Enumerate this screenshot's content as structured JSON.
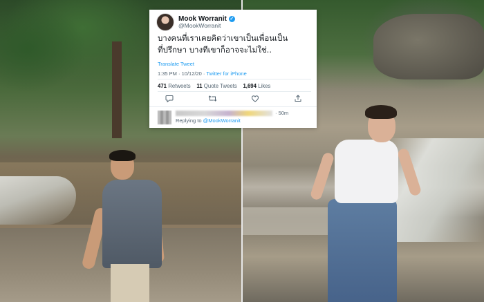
{
  "tweet": {
    "display_name": "Mook Worranit",
    "handle": "@MookWorranit",
    "verified_icon": "verified-badge-icon",
    "text_line1": "บางคนที่เราเคยคิดว่าเขาเป็นเพื่อนเป็น",
    "text_line2": "ที่ปรึกษา บางทีเขาก็อาจจะไม่ใช่..",
    "translate_label": "Translate Tweet",
    "time": "1:35 PM",
    "date": "10/12/20",
    "source": "Twitter for iPhone",
    "retweets_count": "471",
    "retweets_label": "Retweets",
    "quote_count": "11",
    "quote_label": "Quote Tweets",
    "likes_count": "1,694",
    "likes_label": "Likes",
    "actions": [
      "reply-icon",
      "retweet-icon",
      "like-icon",
      "share-icon"
    ],
    "accent_color": "#1d9bf0"
  },
  "reply": {
    "time": "· 50m",
    "replying_prefix": "Replying to",
    "replying_to": "@MookWorranit"
  }
}
